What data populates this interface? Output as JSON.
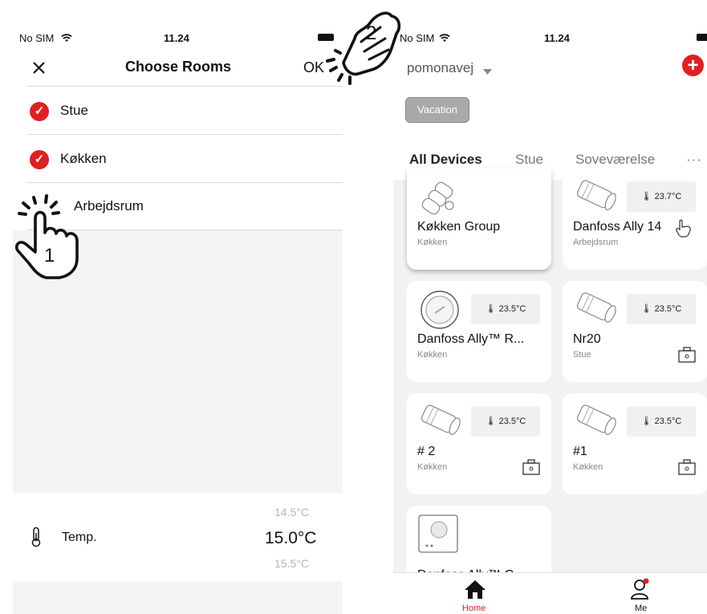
{
  "left_screen": {
    "status": {
      "carrier": "No SIM",
      "time": "11.24"
    },
    "header": {
      "title": "Choose Rooms",
      "ok_label": "OK"
    },
    "rooms": [
      {
        "label": "Stue",
        "checked": true
      },
      {
        "label": "Køkken",
        "checked": true
      },
      {
        "label": "Arbejdsrum",
        "checked": false
      }
    ],
    "temp": {
      "label": "Temp.",
      "above": "14.5°C",
      "value": "15.0°C",
      "below": "15.5°C"
    }
  },
  "right_screen": {
    "status": {
      "carrier": "No SIM",
      "time": "11.24"
    },
    "home_name": "pomonavej",
    "vacation_label": "Vacation",
    "tabs": [
      "All Devices",
      "Stue",
      "Soveværelse"
    ],
    "devices": [
      {
        "title": "Køkken Group",
        "room": "Køkken",
        "temp": ""
      },
      {
        "title": "Danfoss Ally 14",
        "room": "Arbejdsrum",
        "temp": "23.7°C"
      },
      {
        "title": "Danfoss Ally™ R...",
        "room": "Køkken",
        "temp": "23.5°C"
      },
      {
        "title": "Nr20",
        "room": "Stue",
        "temp": "23.5°C"
      },
      {
        "title": "# 2",
        "room": "Køkken",
        "temp": "23.5°C"
      },
      {
        "title": "#1",
        "room": "Køkken",
        "temp": "23.5°C"
      },
      {
        "title": "Danfoss Ally™ G",
        "room": "",
        "temp": ""
      }
    ],
    "tabbar": {
      "home": "Home",
      "me": "Me"
    }
  },
  "annotations": {
    "step1": "1",
    "step2": "2"
  },
  "colors": {
    "accent": "#e02020",
    "vacation_bg": "#a9a9a9"
  }
}
